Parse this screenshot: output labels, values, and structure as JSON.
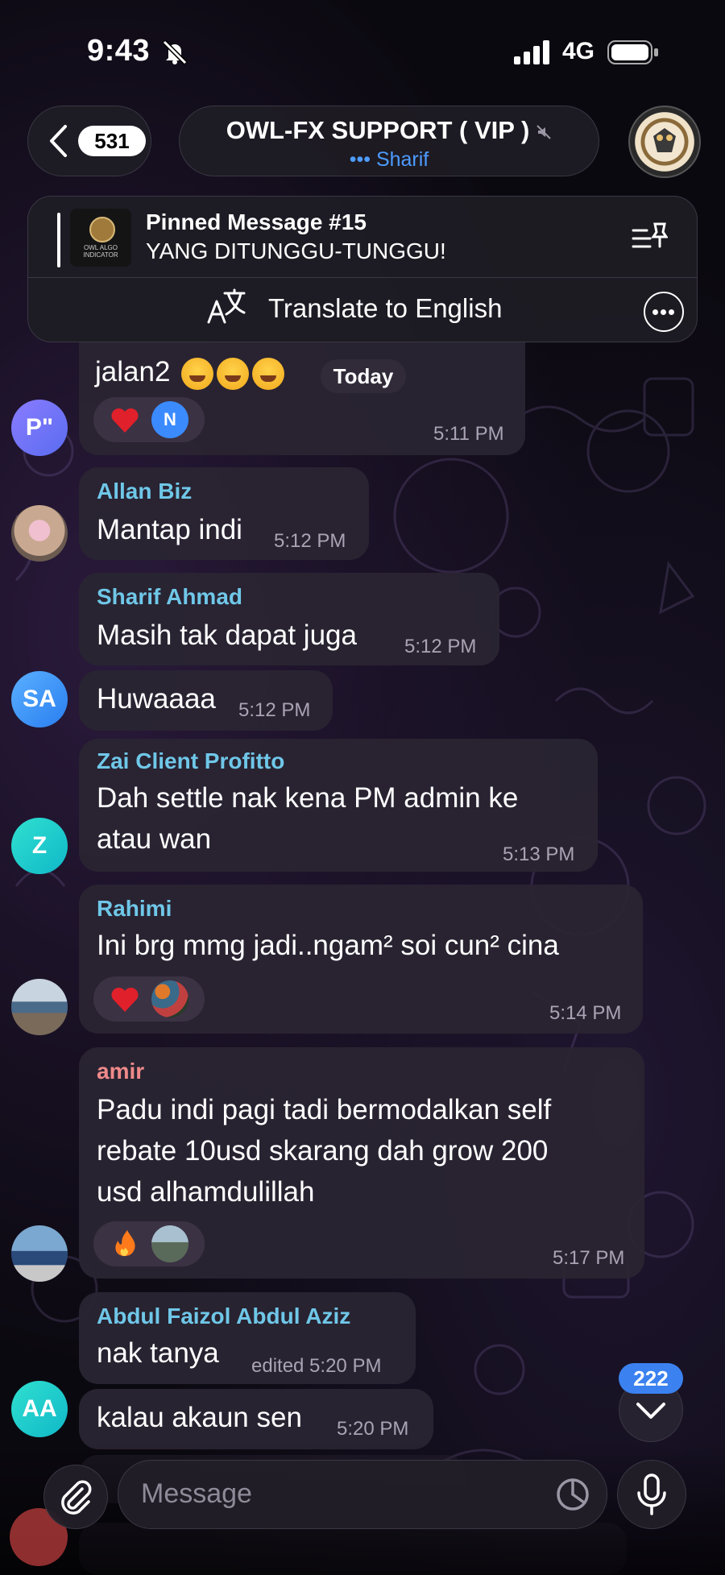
{
  "status": {
    "time": "9:43",
    "network": "4G"
  },
  "header": {
    "back_count": "531",
    "title": "OWL-FX SUPPORT ( VIP )",
    "typing": "••• Sharif"
  },
  "pinned": {
    "title": "Pinned Message #15",
    "text": "YANG DITUNGGU-TUNGGU!",
    "thumb_text": "OWL ALGO INDICATOR",
    "translate_label": "Translate to English"
  },
  "date_badge": "Today",
  "messages": [
    {
      "id": "m1",
      "text": "jalan2",
      "time": "5:11 PM",
      "reaction_initial": "N",
      "avatar": "P\""
    },
    {
      "id": "m2",
      "sender": "Allan Biz",
      "text": "Mantap indi",
      "time": "5:12 PM"
    },
    {
      "id": "m3",
      "sender": "Sharif Ahmad",
      "text": "Masih tak dapat juga",
      "time": "5:12 PM"
    },
    {
      "id": "m4",
      "text": "Huwaaaa",
      "time": "5:12 PM",
      "avatar": "SA"
    },
    {
      "id": "m5",
      "sender": "Zai Client Profitto",
      "text_line1": "Dah settle nak kena PM admin ke",
      "text_line2": "atau wan",
      "time": "5:13 PM",
      "avatar": "Z"
    },
    {
      "id": "m6",
      "sender": "Rahimi",
      "text": "Ini brg mmg jadi..ngam² soi cun² cina",
      "time": "5:14 PM"
    },
    {
      "id": "m7",
      "sender": "amir",
      "text_line1": "Padu indi pagi tadi bermodalkan self",
      "text_line2": "rebate 10usd skarang dah grow 200",
      "text_line3": "usd alhamdulillah",
      "time": "5:17 PM"
    },
    {
      "id": "m8",
      "sender": "Abdul Faizol Abdul Aziz",
      "text": "nak tanya",
      "time": "edited 5:20 PM"
    },
    {
      "id": "m9",
      "text": "kalau akaun sen",
      "time": "5:20 PM",
      "avatar": "AA"
    }
  ],
  "composer": {
    "placeholder": "Message"
  },
  "unread_count": "222",
  "colors": {
    "link_blue": "#4d9cff",
    "sender_teal": "#6fc7e8",
    "sender_red": "#ef8a8a",
    "unread_badge": "#3b82f0"
  },
  "icons": [
    "bell-off-icon",
    "signal-icon",
    "battery-icon",
    "chevron-left-icon",
    "mute-icon",
    "pin-list-icon",
    "translate-icon",
    "more-icon",
    "heart-icon",
    "fire-icon",
    "chevron-down-icon",
    "paperclip-icon",
    "sticker-icon",
    "microphone-icon"
  ]
}
